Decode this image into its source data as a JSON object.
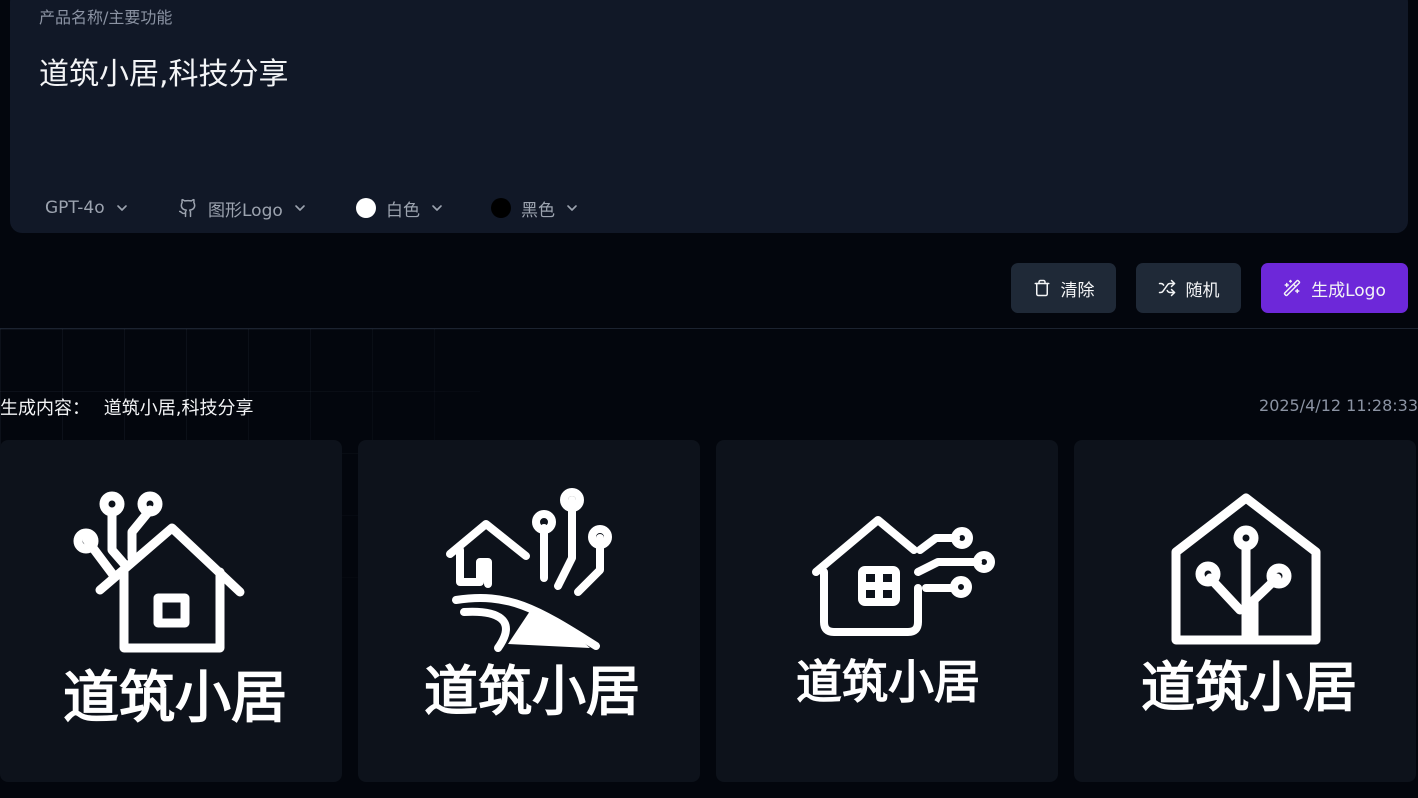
{
  "prompt": {
    "label": "产品名称/主要功能",
    "text": "道筑小居,科技分享"
  },
  "options": {
    "model": "GPT-4o",
    "style": "图形Logo",
    "background_color_label": "白色",
    "background_color": "#ffffff",
    "foreground_color_label": "黑色",
    "foreground_color": "#000000"
  },
  "actions": {
    "clear": "清除",
    "random": "随机",
    "generate": "生成Logo",
    "accent_color": "#6d28d9"
  },
  "result": {
    "label": "生成内容：",
    "content": "道筑小居,科技分享",
    "timestamp": "2025/4/12 11:28:33"
  },
  "logos": [
    {
      "text": "道筑小居",
      "icon": "circuit-house-icon"
    },
    {
      "text": "道筑小居",
      "icon": "house-road-circuit-icon"
    },
    {
      "text": "道筑小居",
      "icon": "house-window-circuit-icon"
    },
    {
      "text": "道筑小居",
      "icon": "house-outline-circuit-icon"
    }
  ]
}
